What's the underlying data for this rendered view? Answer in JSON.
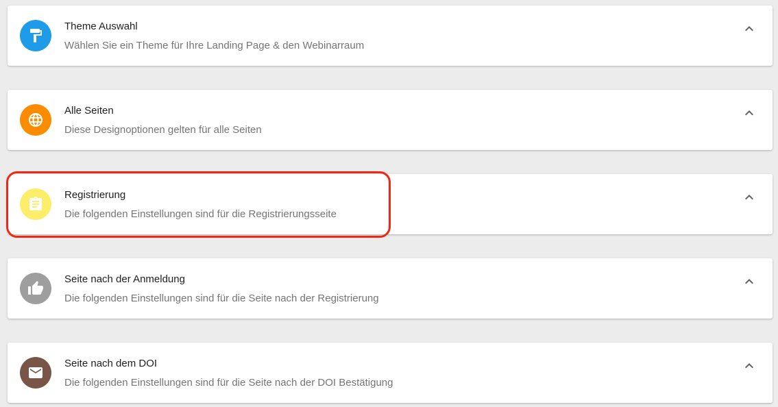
{
  "panels": [
    {
      "title": "Theme Auswahl",
      "subtitle": "Wählen Sie ein Theme für Ihre Landing Page & den Webinarraum",
      "icon": "paint-roller-icon",
      "icon_bg": "#1e9be9"
    },
    {
      "title": "Alle Seiten",
      "subtitle": "Diese Designoptionen gelten für alle Seiten",
      "icon": "globe-icon",
      "icon_bg": "#fb8c00"
    },
    {
      "title": "Registrierung",
      "subtitle": "Die folgenden Einstellungen sind für die Registrierungsseite",
      "icon": "clipboard-icon",
      "icon_bg": "#fdee6a"
    },
    {
      "title": "Seite nach der Anmeldung",
      "subtitle": "Die folgenden Einstellungen sind für die Seite nach der Registrierung",
      "icon": "thumbs-up-icon",
      "icon_bg": "#9e9e9e"
    },
    {
      "title": "Seite nach dem DOI",
      "subtitle": "Die folgenden Einstellungen sind für die Seite nach der DOI Bestätigung",
      "icon": "envelope-icon",
      "icon_bg": "#795548"
    }
  ],
  "highlight_color": "#f22613"
}
